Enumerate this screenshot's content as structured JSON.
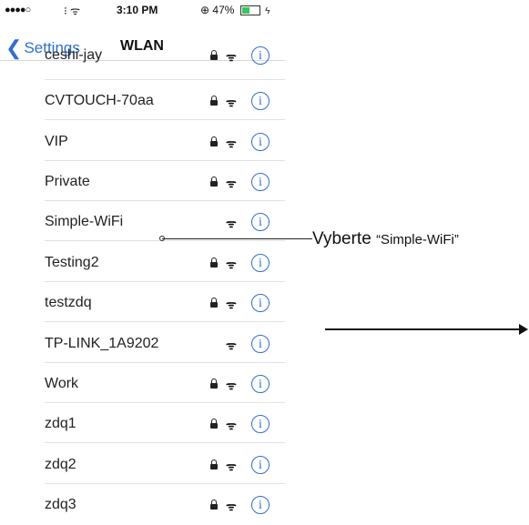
{
  "status_bar": {
    "signal": "●●●●○",
    "carrier_glyph": "⁝ ᯤ",
    "time": "3:10 PM",
    "location_glyph": "⊕",
    "battery_percent": "47%",
    "battery_level": 0.47,
    "charging_glyph": "ϟ"
  },
  "nav": {
    "back_label": "Settings",
    "title": "WLAN"
  },
  "networks": [
    {
      "name": "ceshi-jay",
      "locked": true
    },
    {
      "name": "CVTOUCH-70aa",
      "locked": true
    },
    {
      "name": "VIP",
      "locked": true
    },
    {
      "name": "Private",
      "locked": true
    },
    {
      "name": "Simple-WiFi",
      "locked": false
    },
    {
      "name": "Testing2",
      "locked": true
    },
    {
      "name": "testzdq",
      "locked": true
    },
    {
      "name": "TP-LINK_1A9202",
      "locked": false
    },
    {
      "name": "Work",
      "locked": true
    },
    {
      "name": "zdq1",
      "locked": true
    },
    {
      "name": "zdq2",
      "locked": true
    },
    {
      "name": "zdq3",
      "locked": true
    }
  ],
  "icons": {
    "wifi": "ᯤ",
    "info": "i",
    "back_chevron": "❮"
  },
  "annotation": {
    "label": "Vyberte",
    "quoted": "“Simple-WiFi”"
  },
  "colors": {
    "accent": "#2d6fd6",
    "battery": "#34c759"
  }
}
